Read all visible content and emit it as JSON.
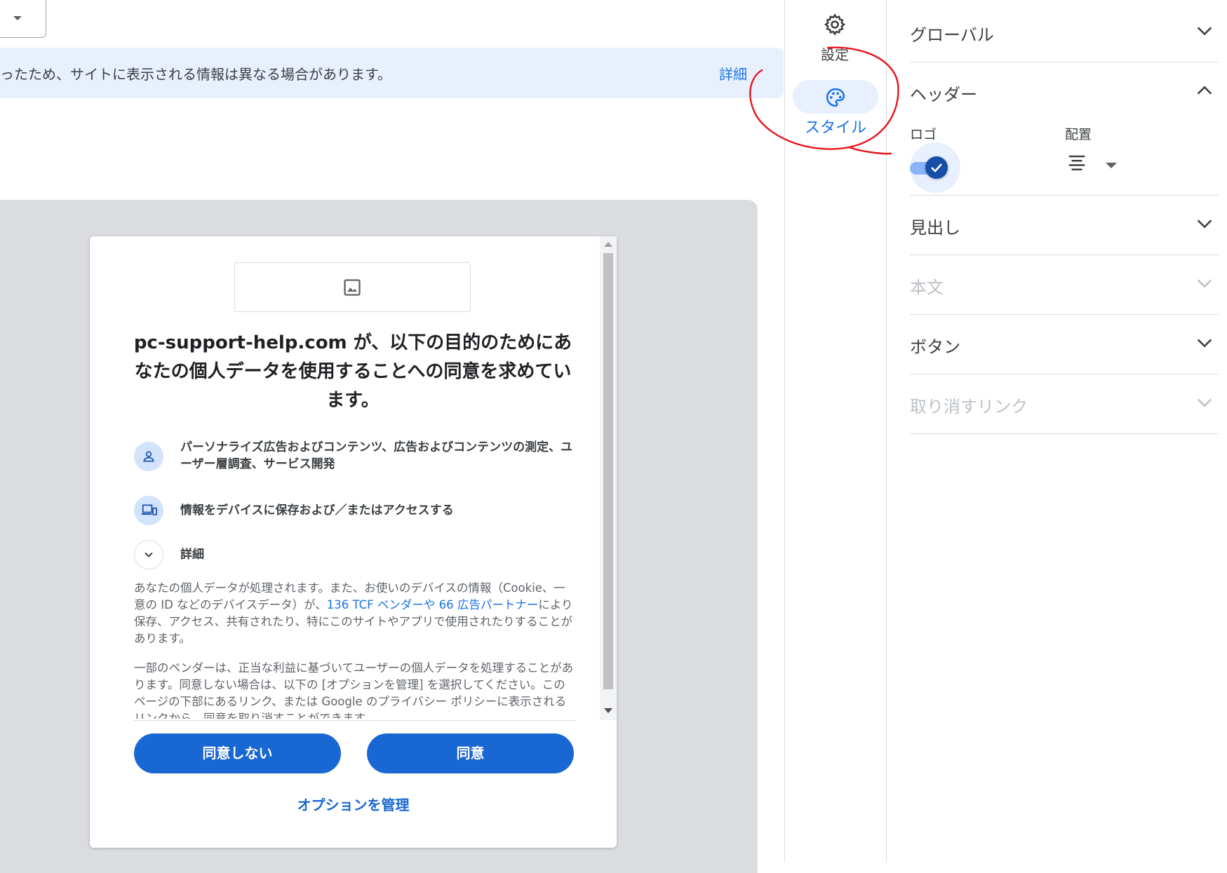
{
  "notice": {
    "message": "ったため、サイトに表示される情報は異なる場合があります。",
    "details_link": "詳細"
  },
  "consent": {
    "title": "pc-support-help.com が、以下の目的のためにあなたの個人データを使用することへの同意を求めています。",
    "purposes": [
      {
        "icon": "person-icon",
        "text": "パーソナライズ広告およびコンテンツ、広告およびコンテンツの測定、ユーザー層調査、サービス開発"
      },
      {
        "icon": "devices-icon",
        "text": "情報をデバイスに保存および／またはアクセスする"
      },
      {
        "icon": "chevron-down-icon",
        "text": "詳細"
      }
    ],
    "body": {
      "p1_before": "あなたの個人データが処理されます。また、お使いのデバイスの情報（Cookie、一意の ID などのデバイスデータ）が、",
      "p1_link": "136 TCF ベンダーや 66 広告パートナー",
      "p1_after": "により保存、アクセス、共有されたり、特にこのサイトやアプリで使用されたりすることがあります。",
      "p2": "一部のベンダーは、正当な利益に基づいてユーザーの個人データを処理することがあります。同意しない場合は、以下の [オプションを管理] を選択してください。このページの下部にあるリンク、または Google のプライバシー ポリシーに表示されるリンクから、同意を取り消すことができます。"
    },
    "disagree_button": "同意しない",
    "agree_button": "同意",
    "manage_options": "オプションを管理"
  },
  "rail": {
    "settings_label": "設定",
    "style_label": "スタイル"
  },
  "panel": {
    "global": "グローバル",
    "header": {
      "title": "ヘッダー",
      "logo_label": "ロゴ",
      "logo_enabled": true,
      "align_label": "配置",
      "align_value_icon": "align-center-icon"
    },
    "heading": "見出し",
    "body": "本文",
    "button": "ボタン",
    "cancel_link": "取り消すリンク"
  },
  "colors": {
    "accent": "#1a73e8",
    "button": "#1967d2",
    "banner": "#e8f0fe",
    "annotation": "#e8141b"
  }
}
